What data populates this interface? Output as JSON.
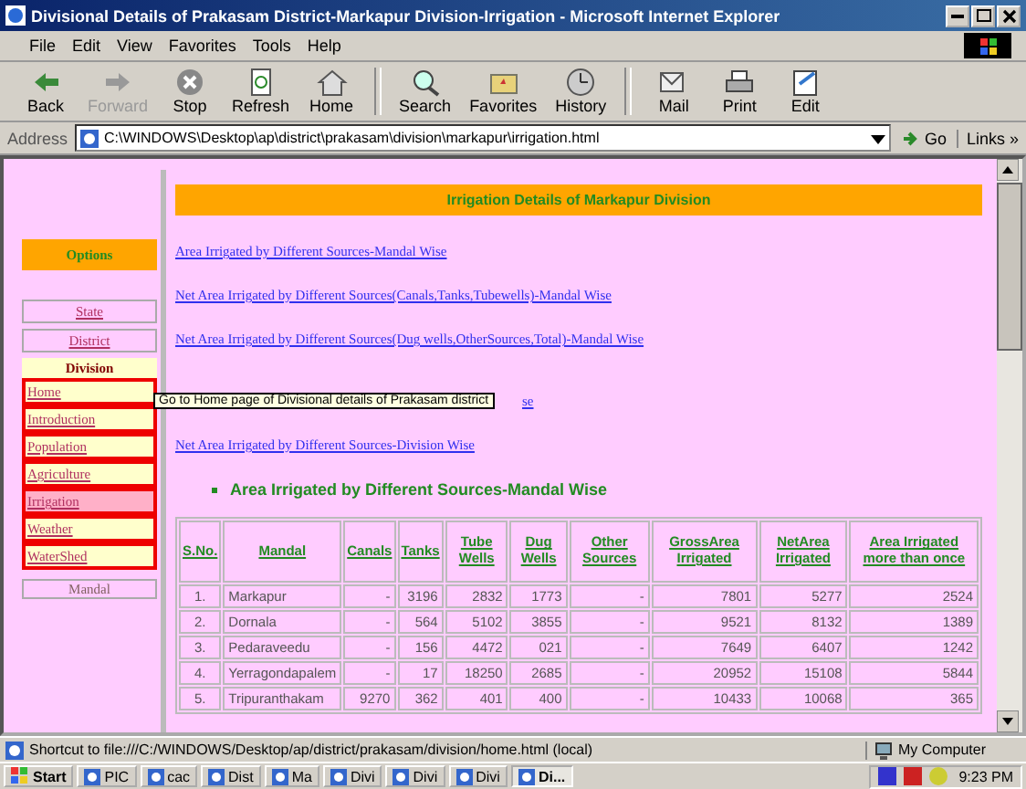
{
  "window": {
    "title": "Divisional Details of Prakasam District-Markapur Division-Irrigation - Microsoft Internet Explorer"
  },
  "menu": [
    {
      "label": "File"
    },
    {
      "label": "Edit"
    },
    {
      "label": "View"
    },
    {
      "label": "Favorites"
    },
    {
      "label": "Tools"
    },
    {
      "label": "Help"
    }
  ],
  "toolbar": [
    {
      "buttons": [
        {
          "label": "Back",
          "disabled": false
        },
        {
          "label": "Forward",
          "disabled": true
        },
        {
          "label": "Stop",
          "disabled": false
        },
        {
          "label": "Refresh",
          "disabled": false
        },
        {
          "label": "Home",
          "disabled": false
        }
      ]
    },
    {
      "buttons": [
        {
          "label": "Search",
          "disabled": false
        },
        {
          "label": "Favorites",
          "disabled": false
        },
        {
          "label": "History",
          "disabled": false
        }
      ]
    },
    {
      "buttons": [
        {
          "label": "Mail",
          "disabled": false
        },
        {
          "label": "Print",
          "disabled": false
        },
        {
          "label": "Edit",
          "disabled": false
        }
      ]
    }
  ],
  "address": {
    "label": "Address",
    "value": "C:\\WINDOWS\\Desktop\\ap\\district\\prakasam\\division\\markapur\\irrigation.html",
    "go": "Go",
    "links": "Links »"
  },
  "sidebar": {
    "options": "Options",
    "items": [
      {
        "label": "State"
      },
      {
        "label": "District"
      }
    ],
    "division": {
      "label": "Division",
      "items": [
        {
          "label": "Home",
          "selected": false
        },
        {
          "label": "Introduction",
          "selected": false
        },
        {
          "label": "Population",
          "selected": false
        },
        {
          "label": "Agriculture",
          "selected": false
        },
        {
          "label": "Irrigation",
          "selected": true
        },
        {
          "label": "Weather",
          "selected": false
        },
        {
          "label": "WaterShed",
          "selected": false
        }
      ]
    },
    "mandal": "Mandal"
  },
  "main": {
    "header": "Irrigation Details of Markapur Division",
    "links": [
      {
        "text": "Area Irrigated by Different Sources-Mandal Wise",
        "kind": "link"
      },
      {
        "text": "Net Area Irrigated by Different Sources(Canals,Tanks,Tubewells)-Mandal Wise",
        "kind": "link"
      },
      {
        "text": "Net Area Irrigated by Different Sources(Dug wells,OtherSources,Total)-Mandal Wise",
        "kind": "link"
      },
      {
        "text": "se",
        "kind": "covered"
      },
      {
        "text": "Net Area Irrigated by Different Sources-Division Wise",
        "kind": "link"
      }
    ],
    "section_title": "Area Irrigated by Different Sources-Mandal Wise",
    "table": {
      "columns": [
        "S.No.",
        "Mandal",
        "Canals",
        "Tanks",
        "Tube Wells",
        "Dug Wells",
        "Other Sources",
        "GrossArea Irrigated",
        "NetArea Irrigated",
        "Area Irrigated more than once"
      ],
      "rows": [
        [
          "1.",
          "Markapur",
          "-",
          "3196",
          "2832",
          "1773",
          "-",
          "7801",
          "5277",
          "2524"
        ],
        [
          "2.",
          "Dornala",
          "-",
          "564",
          "5102",
          "3855",
          "-",
          "9521",
          "8132",
          "1389"
        ],
        [
          "3.",
          "Pedaraveedu",
          "-",
          "156",
          "4472",
          "021",
          "-",
          "7649",
          "6407",
          "1242"
        ],
        [
          "4.",
          "Yerragondapalem",
          "-",
          "17",
          "18250",
          "2685",
          "-",
          "20952",
          "15108",
          "5844"
        ],
        [
          "5.",
          "Tripuranthakam",
          "9270",
          "362",
          "401",
          "400",
          "-",
          "10433",
          "10068",
          "365"
        ]
      ]
    }
  },
  "tooltip": "Go to Home page of Divisional details of Prakasam district",
  "status_bar": {
    "text": "Shortcut to file:///C:/WINDOWS/Desktop/ap/district/prakasam/division/home.html (local)",
    "zone": "My Computer"
  },
  "taskbar": {
    "start": "Start",
    "tasks": [
      {
        "label": "PIC",
        "selected": false
      },
      {
        "label": "cac",
        "selected": false
      },
      {
        "label": "Dist",
        "selected": false
      },
      {
        "label": "Ma",
        "selected": false
      },
      {
        "label": "Divi",
        "selected": false
      },
      {
        "label": "Divi",
        "selected": false
      },
      {
        "label": "Divi",
        "selected": false
      },
      {
        "label": "Di...",
        "selected": true
      }
    ],
    "clock": "9:23 PM"
  }
}
